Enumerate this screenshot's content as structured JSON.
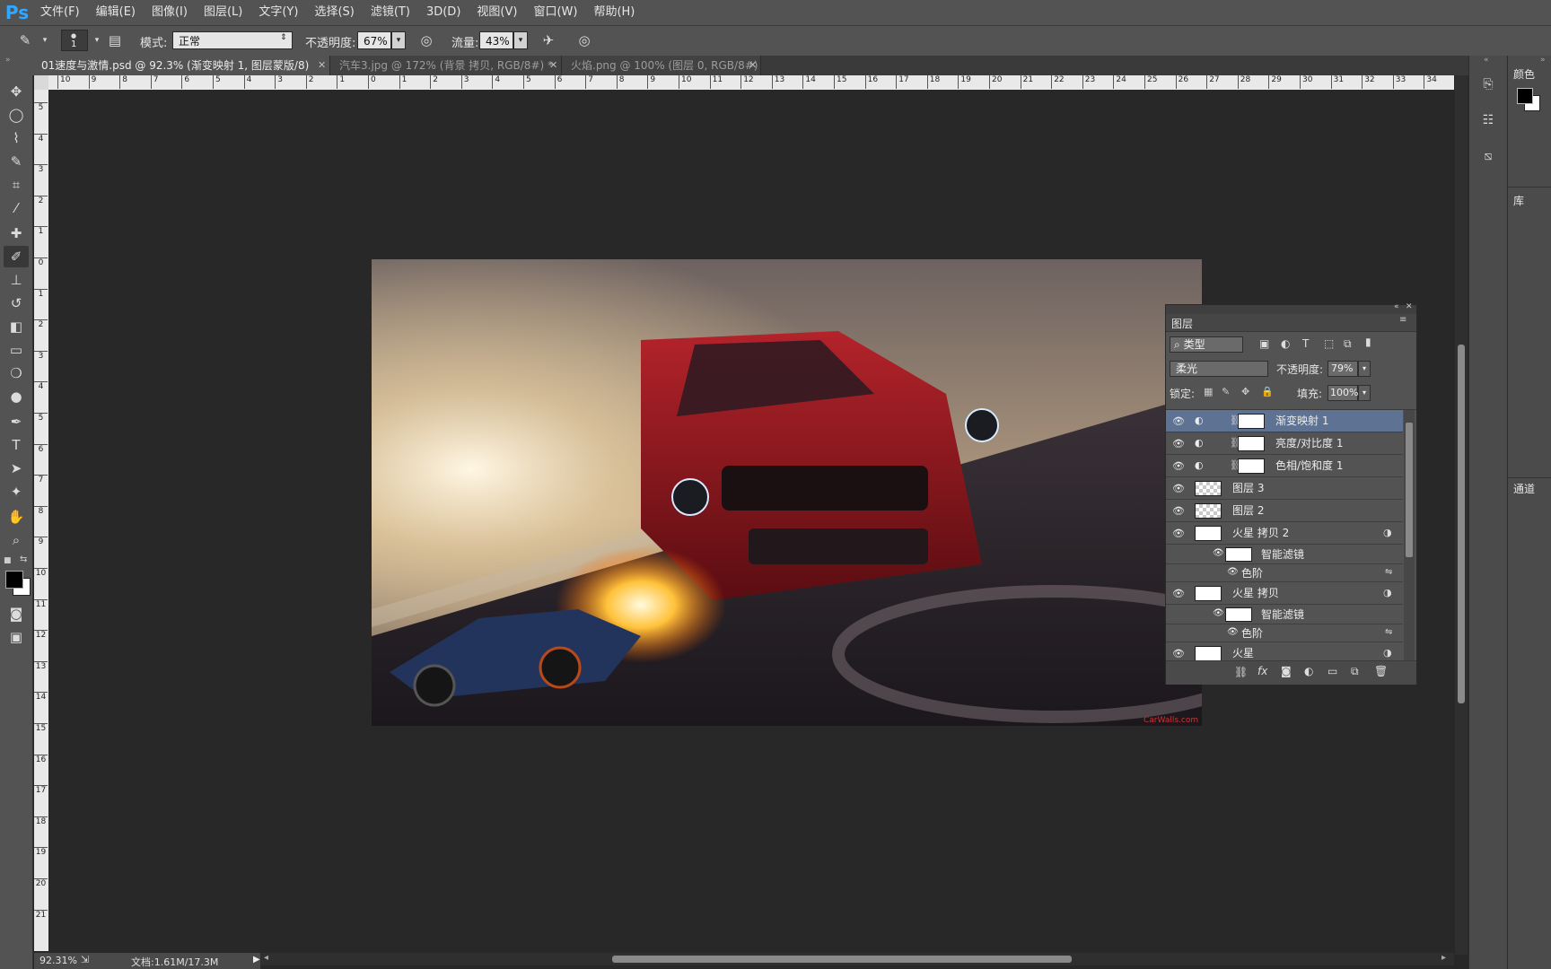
{
  "app": {
    "logo": "Ps"
  },
  "menu": [
    "文件(F)",
    "编辑(E)",
    "图像(I)",
    "图层(L)",
    "文字(Y)",
    "选择(S)",
    "滤镜(T)",
    "3D(D)",
    "视图(V)",
    "窗口(W)",
    "帮助(H)"
  ],
  "options": {
    "brush_size": "1",
    "mode_label": "模式:",
    "mode_value": "正常",
    "opacity_label": "不透明度:",
    "opacity_value": "67%",
    "flow_label": "流量:",
    "flow_value": "43%"
  },
  "tabs": [
    {
      "label": "01速度与激情.psd @ 92.3% (渐变映射 1, 图层蒙版/8)",
      "active": true
    },
    {
      "label": "汽车3.jpg @ 172% (背景 拷贝, RGB/8#) *",
      "active": false
    },
    {
      "label": "火焰.png @ 100% (图层 0, RGB/8#)",
      "active": false
    }
  ],
  "ruler_top": [
    "10",
    "9",
    "8",
    "7",
    "6",
    "5",
    "4",
    "3",
    "2",
    "1",
    "0",
    "1",
    "2",
    "3",
    "4",
    "5",
    "6",
    "7",
    "8",
    "9",
    "10",
    "11",
    "12",
    "13",
    "14",
    "15",
    "16",
    "17",
    "18",
    "19",
    "20",
    "21",
    "22",
    "23",
    "24",
    "25",
    "26",
    "27",
    "28",
    "29",
    "30",
    "31",
    "32",
    "33",
    "34"
  ],
  "ruler_left": [
    "5",
    "4",
    "3",
    "2",
    "1",
    "0",
    "1",
    "2",
    "3",
    "4",
    "5",
    "6",
    "7",
    "8",
    "9",
    "10",
    "11",
    "12",
    "13",
    "14",
    "15",
    "16",
    "17",
    "18",
    "19",
    "20",
    "21"
  ],
  "artwork": {
    "watermark": "CarWalls.com"
  },
  "status": {
    "zoom": "92.31%",
    "doc": "文档:1.61M/17.3M"
  },
  "right_dock": {
    "color_tab": "颜色",
    "library_tab": "库",
    "channels_tab": "通道"
  },
  "layers_panel": {
    "title": "图层",
    "filter_kind": "类型",
    "blend_mode": "柔光",
    "opacity_label": "不透明度:",
    "opacity_value": "79%",
    "lock_label": "锁定:",
    "fill_label": "填充:",
    "fill_value": "100%",
    "layers": [
      {
        "name": "渐变映射 1",
        "kind": "adjustment",
        "selected": true
      },
      {
        "name": "亮度/对比度 1",
        "kind": "adjustment"
      },
      {
        "name": "色相/饱和度 1",
        "kind": "adjustment"
      },
      {
        "name": "图层 3",
        "kind": "pixel"
      },
      {
        "name": "图层 2",
        "kind": "pixel"
      },
      {
        "name": "火星 拷贝 2",
        "kind": "smart",
        "filters_label": "智能滤镜",
        "filter": "色阶"
      },
      {
        "name": "火星 拷贝",
        "kind": "smart",
        "filters_label": "智能滤镜",
        "filter": "色阶"
      },
      {
        "name": "火星",
        "kind": "smart"
      }
    ]
  }
}
